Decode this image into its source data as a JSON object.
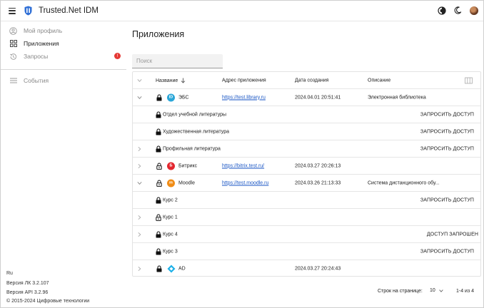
{
  "header": {
    "title": "Trusted.Net IDM",
    "icons": [
      "menu-icon",
      "trusted-logo-icon",
      "contrast-icon",
      "moon-icon",
      "avatar"
    ]
  },
  "sidebar": {
    "items": [
      {
        "label": "Мой профиль",
        "icon": "account-circle-icon"
      },
      {
        "label": "Приложения",
        "icon": "apps-grid-icon"
      },
      {
        "label": "Запросы",
        "icon": "history-icon",
        "badge": "!"
      },
      {
        "label": "События",
        "icon": "list-lines-icon"
      }
    ],
    "footer": {
      "lang": "Ru",
      "lk_version": "Версия ЛК 3.2.107",
      "api_version": "Версия API 3.2.96",
      "copyright": "© 2015-2024 Цифровые технологии"
    }
  },
  "main": {
    "title": "Приложения",
    "search_placeholder": "Поиск",
    "columns": {
      "name": "Название",
      "url": "Адрес приложения",
      "date": "Дата создания",
      "desc": "Описание"
    },
    "rows": [
      {
        "kind": "app",
        "expanded": true,
        "name": "ЭБС",
        "logo_text": "ID",
        "url": "https://test.library.ru",
        "date": "2024.04.01 20:51:41",
        "desc": "Электронная библиотека"
      },
      {
        "kind": "child",
        "name": "Отдел учебной литературы",
        "action": "ЗАПРОСИТЬ ДОСТУП"
      },
      {
        "kind": "child",
        "name": "Художественная литература",
        "action": "ЗАПРОСИТЬ ДОСТУП"
      },
      {
        "kind": "child",
        "collapsed": true,
        "name": "Профильная литература",
        "action": "ЗАПРОСИТЬ ДОСТУП"
      },
      {
        "kind": "app",
        "collapsed": true,
        "open_lock": true,
        "name": "Битрикс",
        "logo_text": "Б",
        "url": "https://bitrix.test.ru/",
        "date": "2024.03.27 20:26:13",
        "desc": ""
      },
      {
        "kind": "app",
        "expanded": true,
        "open_lock": true,
        "name": "Moodle",
        "logo_text": "m",
        "url": "https://test.moodle.ru",
        "date": "2024.03.26 21:13:33",
        "desc": "Система дистанционного обу..."
      },
      {
        "kind": "child",
        "name": "Курс 2",
        "action": "ЗАПРОСИТЬ ДОСТУП"
      },
      {
        "kind": "child",
        "collapsed": true,
        "open_lock": true,
        "name": "Курс 1",
        "action": ""
      },
      {
        "kind": "child",
        "collapsed": true,
        "name": "Курс 4",
        "action": "ДОСТУП ЗАПРОШЕН"
      },
      {
        "kind": "child",
        "name": "Курс 3",
        "action": "ЗАПРОСИТЬ ДОСТУП"
      },
      {
        "kind": "app",
        "collapsed": true,
        "name": "AD",
        "logo_text": "",
        "url": "",
        "date": "2024.03.27 20:24:43",
        "desc": ""
      }
    ],
    "pagination": {
      "rows_per_page_label": "Строк на странице:",
      "rows_per_page": "10",
      "range": "1-4 из 4"
    }
  },
  "colors": {
    "link": "#1a56c4",
    "badge": "#e53935",
    "logo_blue": "#2f6fd6",
    "bitrix_red": "#e3262e",
    "moodle_orange": "#f08c16",
    "ad_cyan": "#1cb0e8"
  }
}
